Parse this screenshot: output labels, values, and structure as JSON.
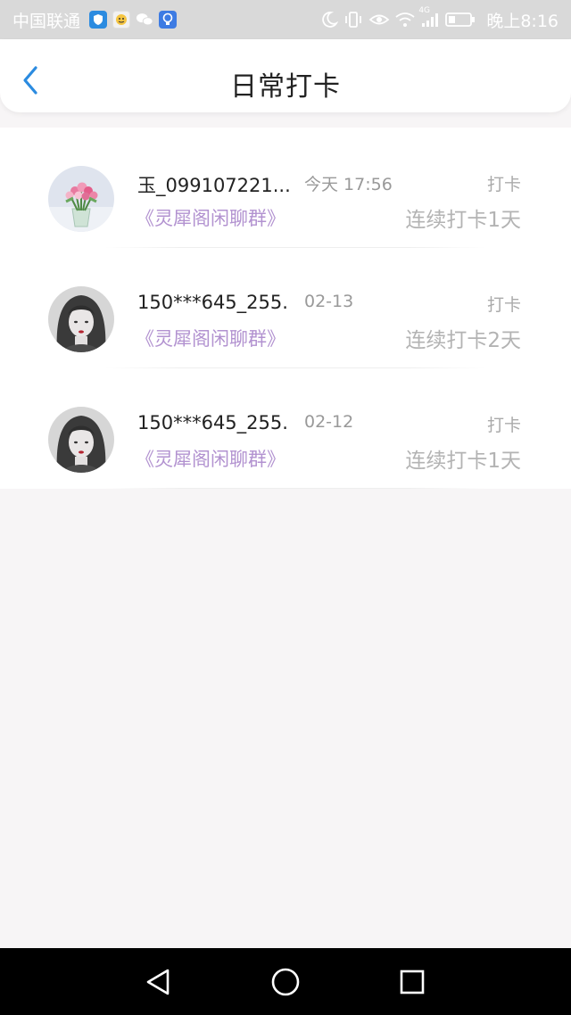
{
  "status_bar": {
    "carrier": "中国联通",
    "time": "晚上8:16",
    "network": "4G",
    "icons": [
      "shield-app-icon",
      "face-app-icon",
      "wechat-icon",
      "bulb-app-icon",
      "moon-icon",
      "vibrate-icon",
      "eye-icon",
      "wifi-icon",
      "signal-icon",
      "battery-icon"
    ]
  },
  "header": {
    "title": "日常打卡",
    "back_icon": "chevron-left-icon",
    "accent": "#2b8be0"
  },
  "records": [
    {
      "name": "玉_099107221...",
      "date": "今天 17:56",
      "action": "打卡",
      "group": "《灵犀阁闲聊群》",
      "streak": "连续打卡1天",
      "avatar": "flower-bouquet-avatar"
    },
    {
      "name": "150***645_255...",
      "date": "02-13",
      "action": "打卡",
      "group": "《灵犀阁闲聊群》",
      "streak": "连续打卡2天",
      "avatar": "girl-portrait-avatar"
    },
    {
      "name": "150***645_255...",
      "date": "02-12",
      "action": "打卡",
      "group": "《灵犀阁闲聊群》",
      "streak": "连续打卡1天",
      "avatar": "girl-portrait-avatar"
    }
  ],
  "colors": {
    "group_link": "#b292d0",
    "page_bg": "#f7f5f6"
  },
  "nav_bar": {
    "icons": [
      "nav-back-icon",
      "nav-home-icon",
      "nav-recent-icon"
    ]
  }
}
